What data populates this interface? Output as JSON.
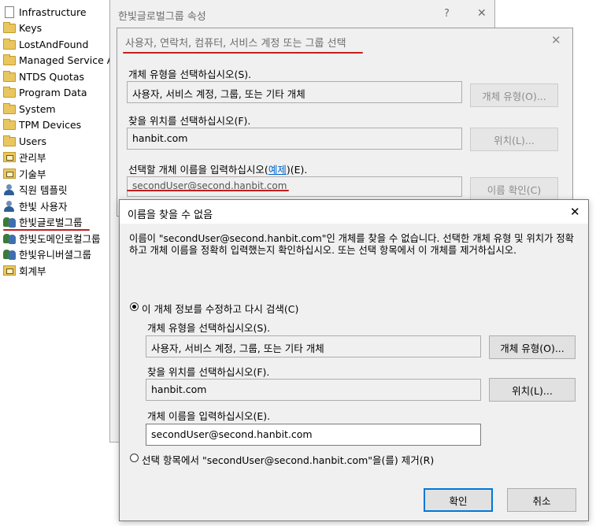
{
  "tree": {
    "items": [
      {
        "label": "Infrastructure",
        "icon": "doc-icon"
      },
      {
        "label": "Keys",
        "icon": "folder-icon"
      },
      {
        "label": "LostAndFound",
        "icon": "folder-icon"
      },
      {
        "label": "Managed Service Ac",
        "icon": "folder-icon"
      },
      {
        "label": "NTDS Quotas",
        "icon": "folder-icon"
      },
      {
        "label": "Program Data",
        "icon": "folder-icon"
      },
      {
        "label": "System",
        "icon": "folder-icon"
      },
      {
        "label": "TPM Devices",
        "icon": "folder-icon"
      },
      {
        "label": "Users",
        "icon": "folder-icon"
      },
      {
        "label": "관리부",
        "icon": "ou-icon"
      },
      {
        "label": "기술부",
        "icon": "ou-icon"
      },
      {
        "label": "직원 템플릿",
        "icon": "user-icon"
      },
      {
        "label": "한빛 사용자",
        "icon": "user-icon"
      },
      {
        "label": "한빛글로벌그룹",
        "icon": "group-icon"
      },
      {
        "label": "한빛도메인로컬그룹",
        "icon": "group-icon"
      },
      {
        "label": "한빛유니버셜그룹",
        "icon": "group-icon"
      },
      {
        "label": "회계부",
        "icon": "ou-icon"
      }
    ]
  },
  "properties_window": {
    "title": "한빛글로벌그룹 속성",
    "help": "?",
    "close": "✕"
  },
  "select_dialog": {
    "title": "사용자, 연락처, 컴퓨터, 서비스 계정 또는 그룹 선택",
    "close": "✕",
    "object_type_label": "개체 유형을 선택하십시오(S).",
    "object_type_value": "사용자, 서비스 계정, 그룹, 또는 기타 개체",
    "object_type_button": "개체 유형(O)...",
    "location_label": "찾을 위치를 선택하십시오(F).",
    "location_value": "hanbit.com",
    "location_button": "위치(L)...",
    "names_label_prefix": "선택할 개체 이름을 입력하십시오(",
    "names_label_link": "예제",
    "names_label_suffix": ")(E).",
    "names_value": "secondUser@second.hanbit.com",
    "check_names_button": "이름 확인(C)"
  },
  "error_dialog": {
    "title": "이름을 찾을 수 없음",
    "close": "✕",
    "message": "이름이 \"secondUser@second.hanbit.com\"인 개체를 찾을 수 없습니다. 선택한 개체 유형 및 위치가 정확하고 개체 이름을 정확히 입력했는지 확인하십시오. 또는 선택 항목에서 이 개체를 제거하십시오.",
    "option_modify_label": "이 개체 정보를 수정하고 다시 검색(C)",
    "object_type_label": "개체 유형을 선택하십시오(S).",
    "object_type_value": "사용자, 서비스 계정, 그룹, 또는 기타 개체",
    "object_type_button": "개체 유형(O)...",
    "location_label": "찾을 위치를 선택하십시오(F).",
    "location_value": "hanbit.com",
    "location_button": "위치(L)...",
    "name_label": "개체 이름을 입력하십시오(E).",
    "name_value": "secondUser@second.hanbit.com",
    "option_remove_label": "선택 항목에서 \"secondUser@second.hanbit.com\"을(를) 제거(R)",
    "ok_button": "확인",
    "cancel_button": "취소"
  },
  "colors": {
    "annotation_red": "#c41e1e",
    "link_blue": "#0066cc",
    "default_button_border": "#0078d7"
  }
}
